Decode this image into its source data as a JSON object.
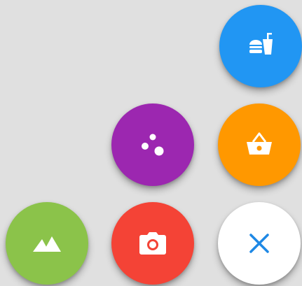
{
  "fab_menu": {
    "state": "expanded",
    "items": [
      {
        "id": "food",
        "icon": "fastfood-icon",
        "color": "#2196f3"
      },
      {
        "id": "bubbles",
        "icon": "bubble-chart-icon",
        "color": "#9c27b0"
      },
      {
        "id": "basket",
        "icon": "shopping-basket-icon",
        "color": "#ff9800"
      },
      {
        "id": "landscape",
        "icon": "landscape-icon",
        "color": "#8bc34a"
      },
      {
        "id": "camera",
        "icon": "camera-icon",
        "color": "#f44336"
      }
    ],
    "main_button": {
      "icon": "close-icon",
      "color": "#ffffff",
      "icon_color": "#1e88e5"
    }
  }
}
